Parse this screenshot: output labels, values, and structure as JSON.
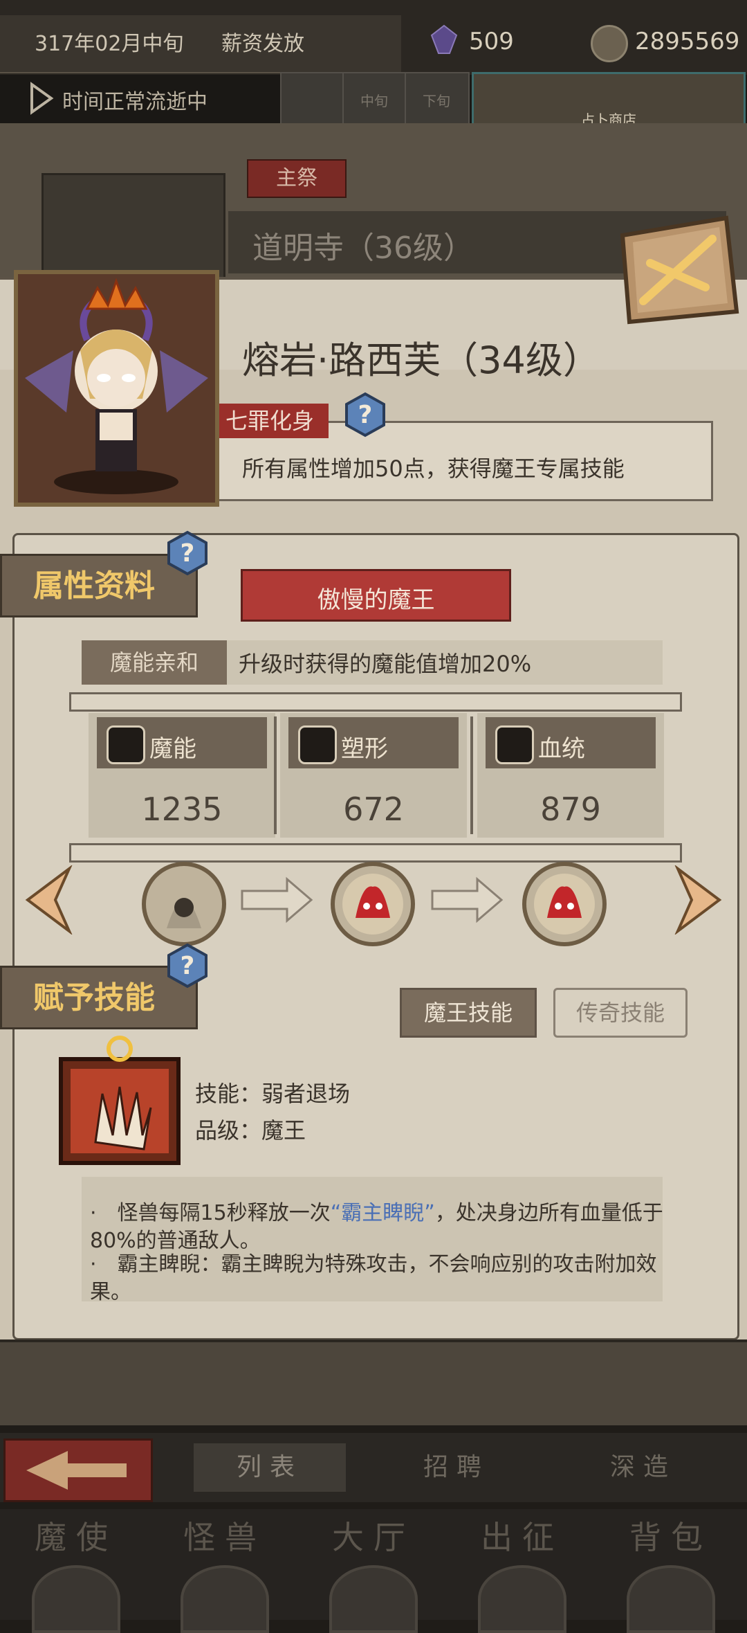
{
  "header": {
    "date": "317年02月中旬",
    "event": "薪资发放",
    "gems": "509",
    "coins": "2895569",
    "time_status": "时间正常流逝中",
    "period_segments": [
      "",
      "中旬",
      "下旬"
    ],
    "shop_label": "占卜商店"
  },
  "altar": {
    "tag": "主祭",
    "temple": "道明寺（36级）"
  },
  "character": {
    "name": "熔岩·路西芙（34级）",
    "trait_badge": "七罪化身",
    "trait_desc": "所有属性增加50点，获得魔王专属技能"
  },
  "attributes": {
    "section_title": "属性资料",
    "class_name": "傲慢的魔王",
    "affinity_tag": "魔能亲和",
    "affinity_desc": "升级时获得的魔能值增加20%",
    "stats": [
      {
        "label": "魔能",
        "value": "1235",
        "icon": "magic-icon"
      },
      {
        "label": "塑形",
        "value": "672",
        "icon": "body-icon"
      },
      {
        "label": "血统",
        "value": "879",
        "icon": "bloodline-icon"
      }
    ]
  },
  "skills": {
    "section_title": "赋予技能",
    "tab_demon": "魔王技能",
    "tab_legend": "传奇技能",
    "skill_name": "技能：弱者退场",
    "skill_grade": "品级：魔王",
    "desc_line1_a": "·　怪兽每隔15秒释放一次",
    "desc_line1_hl": "“霸主睥睨”",
    "desc_line1_b": "，处决身边所有血量低于80%的普通敌人。",
    "desc_line2": "·　霸主睥睨：霸主睥睨为特殊攻击，不会响应别的攻击附加效果。"
  },
  "bottom_tabs": {
    "list": "列表",
    "recruit": "招聘",
    "deep": "深造"
  },
  "nav": [
    "魔使",
    "怪兽",
    "大厅",
    "出征",
    "背包"
  ],
  "colors": {
    "accent_red": "#b03a36",
    "gold_text": "#f0c86a",
    "highlight_blue": "#4a6fb5"
  }
}
